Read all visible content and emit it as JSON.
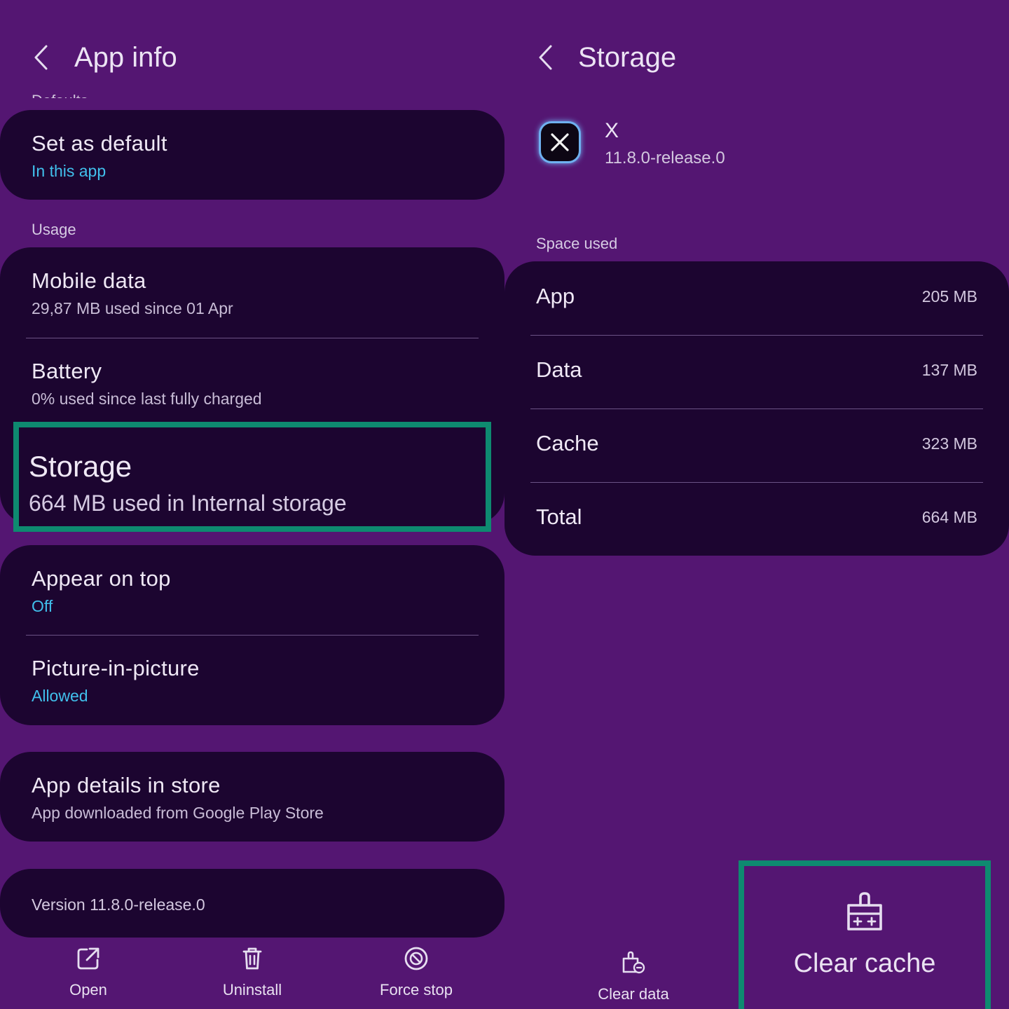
{
  "app_info": {
    "title": "App info",
    "cutoff_label": "Defaults",
    "set_default": {
      "title": "Set as default",
      "subtitle": "In this app"
    },
    "usage_label": "Usage",
    "mobile_data": {
      "title": "Mobile data",
      "subtitle": "29,87 MB used since 01 Apr"
    },
    "battery": {
      "title": "Battery",
      "subtitle": "0% used since last fully charged"
    },
    "storage": {
      "title": "Storage",
      "subtitle": "664 MB used in Internal storage"
    },
    "appear_on_top": {
      "title": "Appear on top",
      "subtitle": "Off"
    },
    "pip": {
      "title": "Picture-in-picture",
      "subtitle": "Allowed"
    },
    "store": {
      "title": "App details in store",
      "subtitle": "App downloaded from Google Play Store"
    },
    "version": "Version 11.8.0-release.0",
    "bottom": {
      "open": "Open",
      "uninstall": "Uninstall",
      "force_stop": "Force stop"
    }
  },
  "storage_screen": {
    "title": "Storage",
    "app_name": "X",
    "app_version": "11.8.0-release.0",
    "space_used_label": "Space used",
    "rows": [
      {
        "label": "App",
        "value": "205 MB"
      },
      {
        "label": "Data",
        "value": "137 MB"
      },
      {
        "label": "Cache",
        "value": "323 MB"
      },
      {
        "label": "Total",
        "value": "664 MB"
      }
    ],
    "clear_data": "Clear data",
    "clear_cache": "Clear cache"
  },
  "colors": {
    "background": "#541672",
    "card": "#1c0530",
    "accent": "#41c0ec",
    "highlight": "#0e8a70"
  },
  "icons": [
    "chevron-left-icon",
    "open-external-icon",
    "trash-icon",
    "block-icon",
    "clear-data-icon",
    "broom-icon",
    "x-logo-icon"
  ]
}
